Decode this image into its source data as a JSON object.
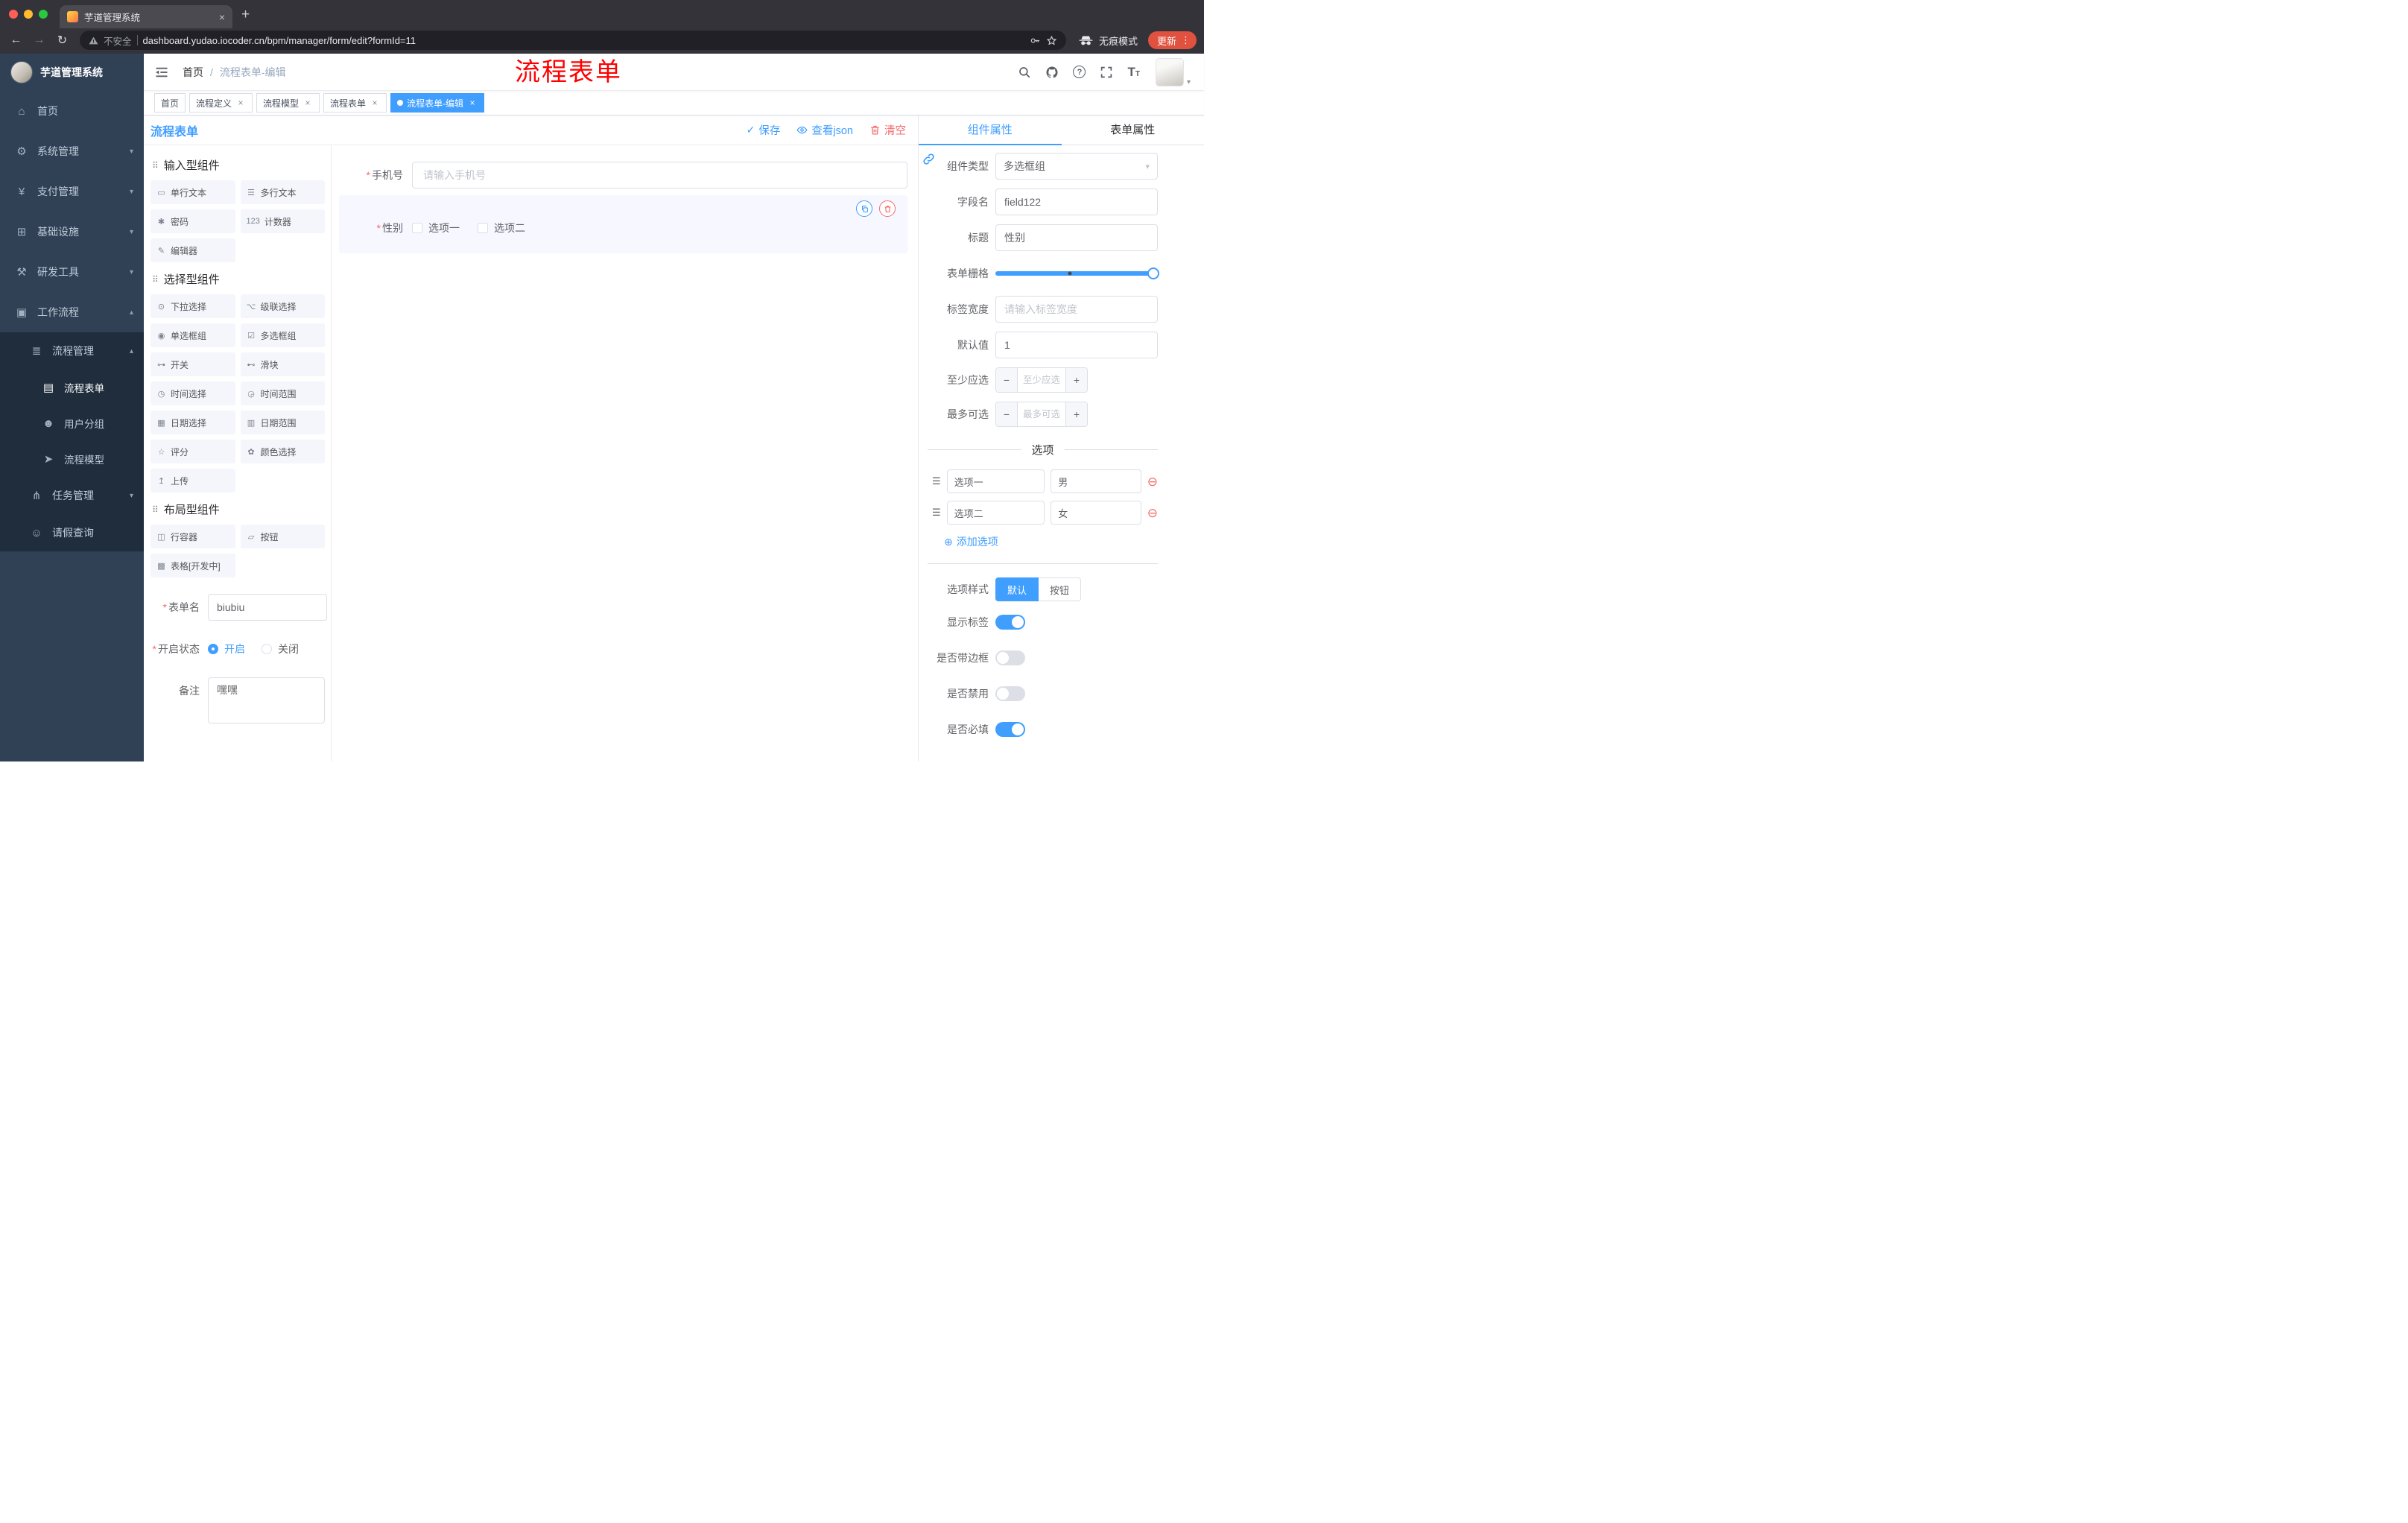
{
  "colors": {
    "primary": "#409eff",
    "danger": "#f56c6c",
    "annotation_red": "#ff0000",
    "sidebar_bg": "#304156",
    "submenu_bg": "#1f2d3d",
    "update_button_bg": "#e0513f",
    "traffic_lights": [
      "#ff5f57",
      "#febc2e",
      "#28c840"
    ]
  },
  "icons": {
    "back": "←",
    "forward": "→",
    "reload": "↻",
    "more_vert": "⋮",
    "new_tab": "+",
    "close": "×",
    "caret_down": "▾",
    "question": "?",
    "check": "✓",
    "minus": "−",
    "plus": "+",
    "add_circle": "⊕",
    "remove_circle": "⊖",
    "drag_dots": "⠿",
    "option_handle": "☰",
    "asterisk": "*",
    "font_size": "T",
    "active_dot": "●"
  },
  "browser": {
    "tab_title": "芋道管理系统",
    "security_label": "不安全",
    "url": "dashboard.yudao.iocoder.cn/bpm/manager/form/edit?formId=11",
    "incognito_label": "无痕模式",
    "update_label": "更新"
  },
  "sidebar": {
    "logo_title": "芋道管理系统",
    "items": [
      {
        "icon": "⌂",
        "label": "首页"
      },
      {
        "icon": "⚙",
        "label": "系统管理",
        "chevron": "▾"
      },
      {
        "icon": "¥",
        "label": "支付管理",
        "chevron": "▾"
      },
      {
        "icon": "⊞",
        "label": "基础设施",
        "chevron": "▾"
      },
      {
        "icon": "⚒",
        "label": "研发工具",
        "chevron": "▾"
      },
      {
        "icon": "▣",
        "label": "工作流程",
        "chevron": "▴"
      },
      {
        "icon": "≣",
        "label": "流程管理",
        "chevron": "▴"
      },
      {
        "icon": "▤",
        "label": "流程表单"
      },
      {
        "icon": "☻",
        "label": "用户分组"
      },
      {
        "icon": "➤",
        "label": "流程模型"
      },
      {
        "icon": "⋔",
        "label": "任务管理",
        "chevron": "▾"
      },
      {
        "icon": "☺",
        "label": "请假查询"
      }
    ]
  },
  "navbar": {
    "breadcrumb": [
      "首页",
      "流程表单-编辑"
    ],
    "separator": "/",
    "annotation": "流程表单"
  },
  "tags": [
    {
      "label": "首页"
    },
    {
      "label": "流程定义"
    },
    {
      "label": "流程模型"
    },
    {
      "label": "流程表单"
    },
    {
      "label": "流程表单-编辑"
    }
  ],
  "designer": {
    "title": "流程表单",
    "save_label": "保存",
    "view_json_label": "查看json",
    "clear_label": "清空"
  },
  "palette": {
    "groups": [
      {
        "title": "输入型组件",
        "items": [
          {
            "icon": "▭",
            "label": "单行文本"
          },
          {
            "icon": "☰",
            "label": "多行文本"
          },
          {
            "icon": "✱",
            "label": "密码"
          },
          {
            "icon": "123",
            "label": "计数器"
          },
          {
            "icon": "✎",
            "label": "编辑器"
          }
        ]
      },
      {
        "title": "选择型组件",
        "items": [
          {
            "icon": "⊙",
            "label": "下拉选择"
          },
          {
            "icon": "⌥",
            "label": "级联选择"
          },
          {
            "icon": "◉",
            "label": "单选框组"
          },
          {
            "icon": "☑",
            "label": "多选框组"
          },
          {
            "icon": "⊶",
            "label": "开关"
          },
          {
            "icon": "⊷",
            "label": "滑块"
          },
          {
            "icon": "◷",
            "label": "时间选择"
          },
          {
            "icon": "◶",
            "label": "时间范围"
          },
          {
            "icon": "▦",
            "label": "日期选择"
          },
          {
            "icon": "▥",
            "label": "日期范围"
          },
          {
            "icon": "☆",
            "label": "评分"
          },
          {
            "icon": "✿",
            "label": "颜色选择"
          },
          {
            "icon": "↥",
            "label": "上传"
          }
        ]
      },
      {
        "title": "布局型组件",
        "items": [
          {
            "icon": "◫",
            "label": "行容器"
          },
          {
            "icon": "▱",
            "label": "按钮"
          },
          {
            "icon": "▩",
            "label": "表格[开发中]"
          }
        ]
      }
    ],
    "form": {
      "name_label": "表单名",
      "name_value": "biubiu",
      "status_label": "开启状态",
      "status_on": "开启",
      "status_off": "关闭",
      "remark_label": "备注",
      "remark_value": "嘿嘿"
    }
  },
  "canvas": {
    "phone_label": "手机号",
    "phone_placeholder": "请输入手机号",
    "gender_label": "性别",
    "gender_option1": "选项一",
    "gender_option2": "选项二"
  },
  "props": {
    "tab_component": "组件属性",
    "tab_form": "表单属性",
    "type_label": "组件类型",
    "type_value": "多选框组",
    "field_label": "字段名",
    "field_value": "field122",
    "title_label": "标题",
    "title_value": "性别",
    "grid_label": "表单栅格",
    "label_width_label": "标签宽度",
    "label_width_placeholder": "请输入标签宽度",
    "default_label": "默认值",
    "default_value": "1",
    "min_label": "至少应选",
    "min_placeholder": "至少应选",
    "max_label": "最多可选",
    "max_placeholder": "最多可选",
    "options_title": "选项",
    "options": [
      {
        "label": "选项一",
        "value": "男"
      },
      {
        "label": "选项二",
        "value": "女"
      }
    ],
    "add_option_label": "添加选项",
    "style_label": "选项样式",
    "style_default": "默认",
    "style_button": "按钮",
    "toggle_show_label": "显示标签",
    "toggle_border": "是否带边框",
    "toggle_disabled": "是否禁用",
    "toggle_required": "是否必填"
  }
}
